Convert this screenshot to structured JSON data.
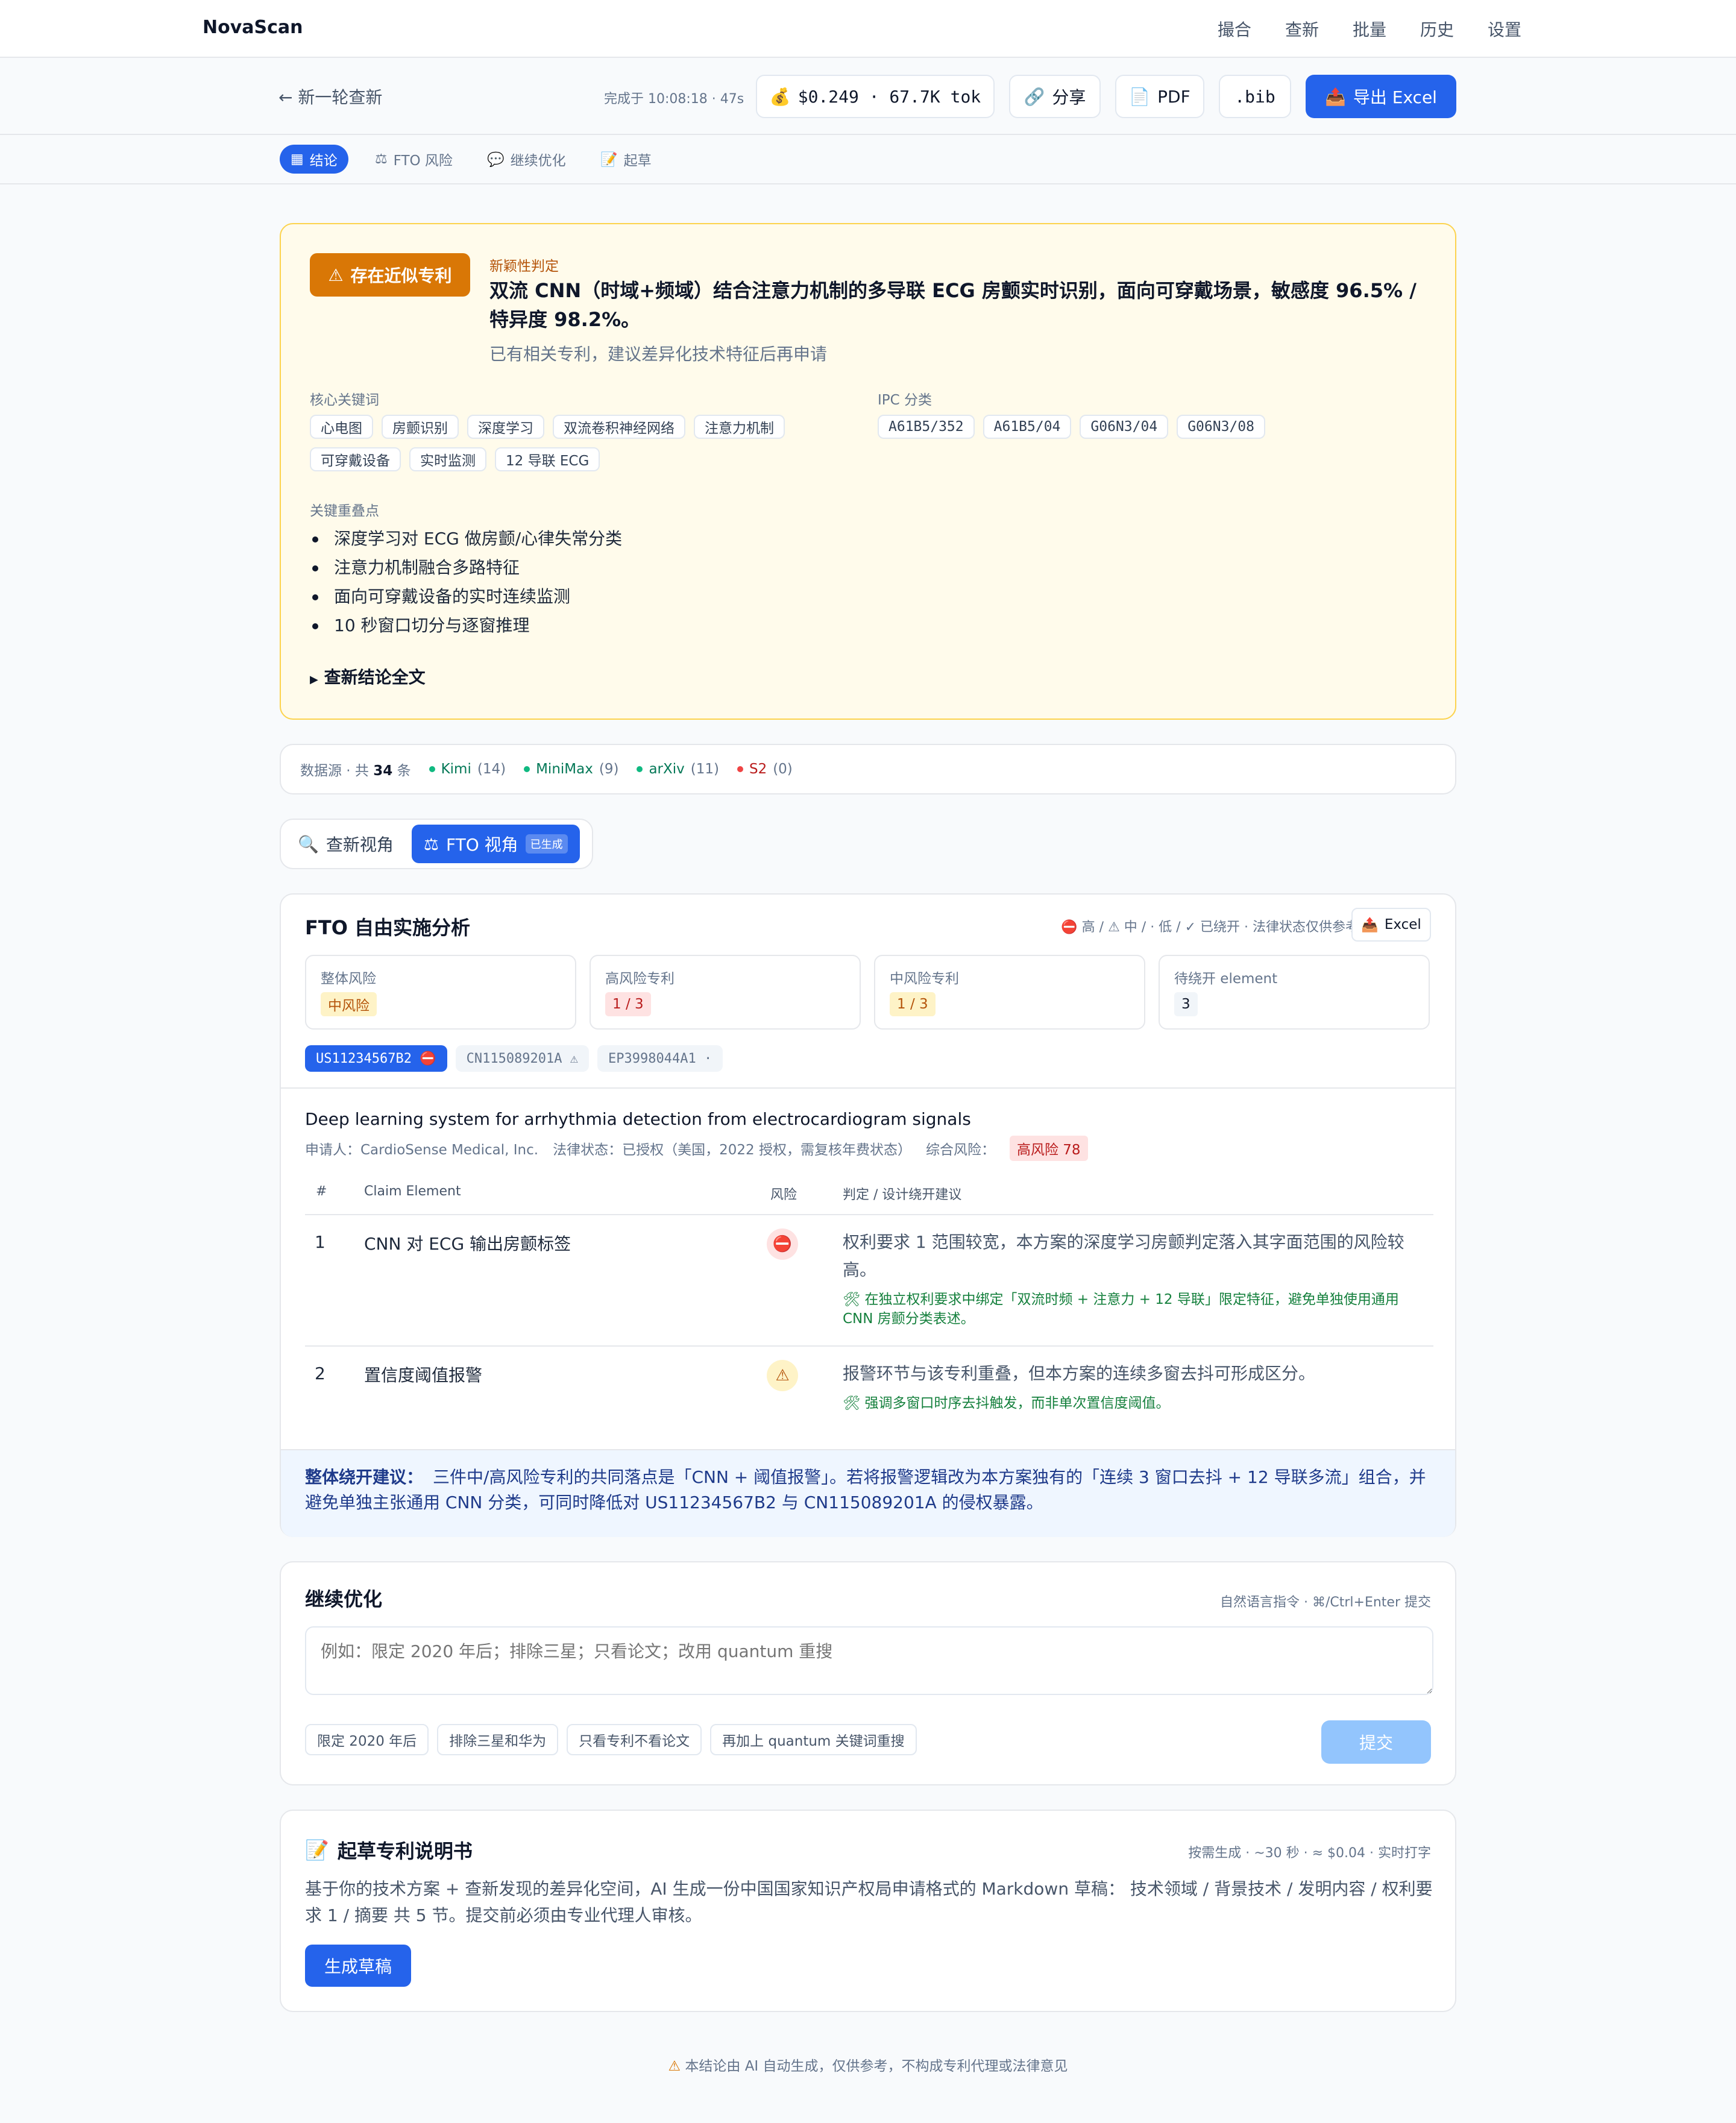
{
  "app": {
    "brand": "NovaScan"
  },
  "nav": [
    "撮合",
    "查新",
    "批量",
    "历史",
    "设置"
  ],
  "actionbar": {
    "back": "← 新一轮查新",
    "completed": "完成于 10:08:18 · 47s",
    "cost": "$0.249 · 67.7K tok",
    "share": "分享",
    "pdf": "PDF",
    "bib": ".bib",
    "export": "导出 Excel"
  },
  "tabs": [
    "结论",
    "FTO 风险",
    "继续优化",
    "起草"
  ],
  "verdict": {
    "badge": "存在近似专利",
    "label": "新颖性判定",
    "title": "双流 CNN（时域+频域）结合注意力机制的多导联 ECG 房颤实时识别，面向可穿戴场景，敏感度 96.5% / 特异度 98.2%。",
    "subtitle": "已有相关专利，建议差异化技术特征后再申请",
    "keywords_label": "核心关键词",
    "keywords": [
      "心电图",
      "房颤识别",
      "深度学习",
      "双流卷积神经网络",
      "注意力机制",
      "可穿戴设备",
      "实时监测",
      "12 导联 ECG"
    ],
    "ipc_label": "IPC 分类",
    "ipc": [
      "A61B5/352",
      "A61B5/04",
      "G06N3/04",
      "G06N3/08"
    ],
    "overlap_label": "关键重叠点",
    "overlaps": [
      "深度学习对 ECG 做房颤/心律失常分类",
      "注意力机制融合多路特征",
      "面向可穿戴设备的实时连续监测",
      "10 秒窗口切分与逐窗推理"
    ],
    "full_text": "查新结论全文"
  },
  "sources": {
    "prefix": "数据源 · 共",
    "total": "34",
    "suffix": "条",
    "items": [
      {
        "name": "Kimi",
        "count": "(14)",
        "color": "#10b981"
      },
      {
        "name": "MiniMax",
        "count": "(9)",
        "color": "#10b981"
      },
      {
        "name": "arXiv",
        "count": "(11)",
        "color": "#10b981"
      },
      {
        "name": "S2",
        "count": "(0)",
        "color": "#ef4444"
      }
    ]
  },
  "view": {
    "novelty": "查新视角",
    "fto": "FTO 视角",
    "fto_badge": "已生成"
  },
  "fto": {
    "title": "FTO 自由实施分析",
    "legend": "⛔ 高 / ⚠ 中 / · 低 / ✓ 已绕开 · 法律状态仅供参考",
    "excel": "Excel",
    "stats": [
      {
        "label": "整体风险",
        "value": "中风险"
      },
      {
        "label": "高风险专利",
        "value": "1 / 3"
      },
      {
        "label": "中风险专利",
        "value": "1 / 3"
      },
      {
        "label": "待绕开 element",
        "value": "3"
      }
    ],
    "patents": [
      "US11234567B2 ⛔",
      "CN115089201A ⚠",
      "EP3998044A1 ·"
    ],
    "patent_title": "Deep learning system for arrhythmia detection from electrocardiogram signals",
    "applicant": "申请人：CardioSense Medical, Inc.",
    "legal": "法律状态：已授权（美国，2022 授权，需复核年费状态）",
    "risk_label": "综合风险：",
    "risk_value": "高风险 78",
    "columns": [
      "#",
      "Claim Element",
      "风险",
      "判定 / 设计绕开建议"
    ],
    "rows": [
      {
        "n": "1",
        "element": "CNN 对 ECG 输出房颤标签",
        "icon": "⛔",
        "judge": "权利要求 1 范围较宽，本方案的深度学习房颤判定落入其字面范围的风险较高。",
        "advice": "🛠 在独立权利要求中绑定「双流时频 + 注意力 + 12 导联」限定特征，避免单独使用通用 CNN 房颤分类表述。"
      },
      {
        "n": "2",
        "element": "置信度阈值报警",
        "icon": "⚠",
        "judge": "报警环节与该专利重叠，但本方案的连续多窗去抖可形成区分。",
        "advice": "🛠 强调多窗口时序去抖触发，而非单次置信度阈值。"
      }
    ],
    "overall_label": "整体绕开建议：",
    "overall_text": "三件中/高风险专利的共同落点是「CNN + 阈值报警」。若将报警逻辑改为本方案独有的「连续 3 窗口去抖 + 12 导联多流」组合，并避免单独主张通用 CNN 分类，可同时降低对 US11234567B2 与 CN115089201A 的侵权暴露。"
  },
  "refine": {
    "title": "继续优化",
    "hint": "自然语言指令 · ⌘/Ctrl+Enter 提交",
    "placeholder": "例如：限定 2020 年后；排除三星；只看论文；改用 quantum 重搜",
    "chips": [
      "限定 2020 年后",
      "排除三星和华为",
      "只看专利不看论文",
      "再加上 quantum 关键词重搜"
    ],
    "submit": "提交"
  },
  "draft": {
    "title": "起草专利说明书",
    "hint": "按需生成 · ~30 秒 · ≈ $0.04 · 实时打字",
    "desc": "基于你的技术方案 + 查新发现的差异化空间，AI 生成一份中国国家知识产权局申请格式的 Markdown 草稿： 技术领域 / 背景技术 / 发明内容 / 权利要求 1 / 摘要 共 5 节。提交前必须由专业代理人审核。",
    "button": "生成草稿"
  },
  "footer": "本结论由 AI 自动生成，仅供参考，不构成专利代理或法律意见"
}
